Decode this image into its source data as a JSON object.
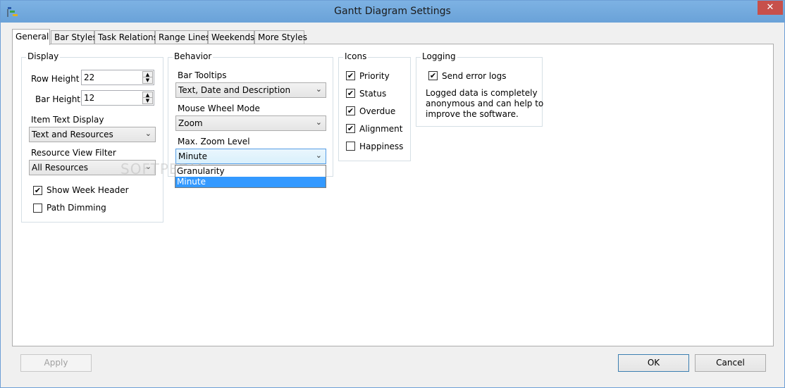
{
  "window": {
    "title": "Gantt Diagram Settings",
    "close_glyph": "✕"
  },
  "tabs": [
    {
      "label": "General",
      "active": true
    },
    {
      "label": "Bar Styles"
    },
    {
      "label": "Task Relations"
    },
    {
      "label": "Range Lines"
    },
    {
      "label": "Weekends"
    },
    {
      "label": "More Styles"
    }
  ],
  "display": {
    "title": "Display",
    "row_height_label": "Row Height",
    "row_height_value": "22",
    "bar_height_label": "Bar Height",
    "bar_height_value": "12",
    "item_text_label": "Item Text Display",
    "item_text_value": "Text and Resources",
    "resource_filter_label": "Resource View Filter",
    "resource_filter_value": "All Resources",
    "show_week_header_label": "Show Week Header",
    "show_week_header_checked": true,
    "path_dimming_label": "Path Dimming",
    "path_dimming_checked": false
  },
  "behavior": {
    "title": "Behavior",
    "bar_tooltips_label": "Bar Tooltips",
    "bar_tooltips_value": "Text, Date and Description",
    "mouse_wheel_label": "Mouse Wheel Mode",
    "mouse_wheel_value": "Zoom",
    "max_zoom_label": "Max. Zoom Level",
    "max_zoom_value": "Minute",
    "max_zoom_options": [
      "Granularity",
      "Minute"
    ]
  },
  "icons": {
    "title": "Icons",
    "items": [
      {
        "label": "Priority",
        "checked": true
      },
      {
        "label": "Status",
        "checked": true
      },
      {
        "label": "Overdue",
        "checked": true
      },
      {
        "label": "Alignment",
        "checked": true
      },
      {
        "label": "Happiness",
        "checked": false
      }
    ]
  },
  "logging": {
    "title": "Logging",
    "send_error_logs_label": "Send error logs",
    "send_error_logs_checked": true,
    "note_line1": "Logged data is completely",
    "note_line2": "anonymous and can help to",
    "note_line3": "improve the software."
  },
  "buttons": {
    "apply": "Apply",
    "ok": "OK",
    "cancel": "Cancel"
  },
  "watermark": "SOFTPEDIA",
  "check_glyph": "✔",
  "spin_up_glyph": "▲",
  "spin_down_glyph": "▼",
  "combo_arrow_glyph": "⌄",
  "colors": {
    "titlebar": "#6fa8dc",
    "close": "#c7504b",
    "selection": "#3399ff"
  }
}
